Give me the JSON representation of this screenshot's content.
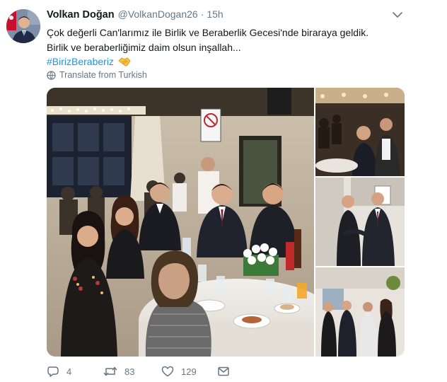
{
  "tweet": {
    "author_name": "Volkan Doğan",
    "author_handle": "@VolkanDogan26",
    "separator": "·",
    "timestamp": "15h",
    "text_line1": "Çok değerli Can'larımız ile Birlik ve Beraberlik Gecesi'nde biraraya geldik.",
    "text_line2": "Birlik ve beraberliğimiz daim olsun inşallah...",
    "hashtag": "#BirizBeraberiz",
    "translate_label": "Translate from Turkish"
  },
  "icons": {
    "caret": "chevron-down-icon",
    "translate": "globe-icon",
    "reply": "reply-icon",
    "retweet": "retweet-icon",
    "like": "heart-icon",
    "message": "envelope-icon",
    "emoji": "handshake-emoji"
  },
  "actions": {
    "reply_count": "4",
    "retweet_count": "83",
    "like_count": "129"
  },
  "colors": {
    "text": "#14171a",
    "secondary": "#657786",
    "link": "#1b95e0"
  }
}
